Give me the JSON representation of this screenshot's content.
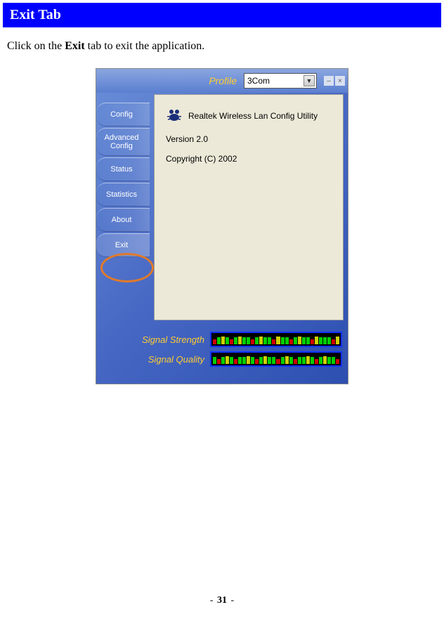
{
  "header": {
    "title": "Exit Tab"
  },
  "instruction": {
    "prefix": "Click on the ",
    "bold": "Exit",
    "suffix": " tab to exit the application."
  },
  "app": {
    "profile_label": "Profile",
    "profile_value": "3Com",
    "tabs": [
      "Config",
      "Advanced Config",
      "Status",
      "Statistics",
      "About",
      "Exit"
    ],
    "content": {
      "title": "Realtek Wireless Lan Config Utility",
      "version": "Version 2.0",
      "copyright": "Copyright (C) 2002"
    },
    "signal_strength_label": "Signal Strength",
    "signal_quality_label": "Signal Quality"
  },
  "footer": {
    "page": "31"
  }
}
